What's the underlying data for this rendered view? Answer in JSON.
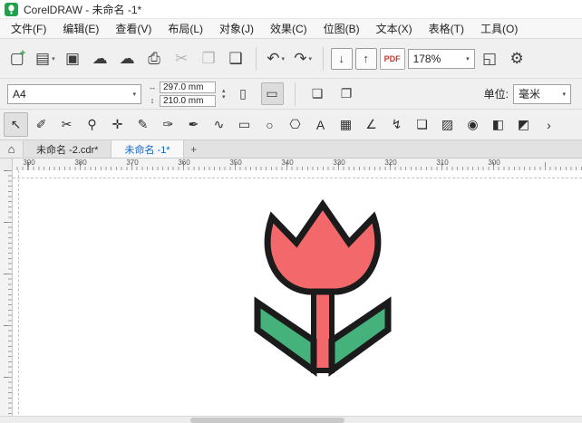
{
  "window": {
    "title": "CorelDRAW - 未命名 -1*"
  },
  "menu_bar": {
    "items": [
      "文件(F)",
      "编辑(E)",
      "查看(V)",
      "布局(L)",
      "对象(J)",
      "效果(C)",
      "位图(B)",
      "文本(X)",
      "表格(T)",
      "工具(O)"
    ]
  },
  "standard_toolbar": {
    "caret_glyph": "▾",
    "zoom_level": "178%",
    "buttons": {
      "new": {
        "glyph": "▢",
        "plus_glyph": "+"
      },
      "open": {
        "glyph": "▤",
        "has_menu": true
      },
      "save": {
        "glyph": "▣"
      },
      "cloud_download": {
        "glyph": "☁"
      },
      "cloud_upload": {
        "glyph": "☁"
      },
      "print": {
        "glyph": "⎙"
      },
      "cut": {
        "glyph": "✂",
        "disabled": true
      },
      "copy": {
        "glyph": "❐",
        "disabled": true
      },
      "paste": {
        "glyph": "❑"
      },
      "undo": {
        "glyph": "↶",
        "has_menu": true
      },
      "redo": {
        "glyph": "↷",
        "has_menu": true
      },
      "import": {
        "glyph": "↓"
      },
      "export": {
        "glyph": "↑"
      },
      "pdf": {
        "glyph": "PDF"
      },
      "fullscreen_preview": {
        "glyph": "◱"
      },
      "options": {
        "glyph": "⚙"
      }
    }
  },
  "property_bar": {
    "page_size": "A4",
    "width_value": "297.0 mm",
    "height_value": "210.0 mm",
    "width_icon": "↔",
    "height_icon": "↕",
    "spinner_up": "▴",
    "spinner_down": "▾",
    "portrait_glyph": "▯",
    "landscape_glyph": "▭",
    "current_page_glyph": "❏",
    "all_pages_glyph": "❐",
    "units_label": "单位:",
    "units_value": "毫米",
    "caret_glyph": "▾"
  },
  "toolbox": {
    "tools": [
      {
        "name": "pick-tool",
        "glyph": "↖",
        "active": true
      },
      {
        "name": "shape-tool",
        "glyph": "✐"
      },
      {
        "name": "crop-tool",
        "glyph": "✂"
      },
      {
        "name": "zoom-tool",
        "glyph": "⚲"
      },
      {
        "name": "pan-tool",
        "glyph": "✛"
      },
      {
        "name": "freehand-tool",
        "glyph": "✎"
      },
      {
        "name": "artistic-media-tool",
        "glyph": "✑"
      },
      {
        "name": "pen-tool",
        "glyph": "✒"
      },
      {
        "name": "bezier-tool",
        "glyph": "∿"
      },
      {
        "name": "rectangle-tool",
        "glyph": "▭"
      },
      {
        "name": "ellipse-tool",
        "glyph": "○"
      },
      {
        "name": "polygon-tool",
        "glyph": "⎔"
      },
      {
        "name": "text-tool",
        "glyph": "A"
      },
      {
        "name": "table-tool",
        "glyph": "▦"
      },
      {
        "name": "dimension-tool",
        "glyph": "∠"
      },
      {
        "name": "connector-tool",
        "glyph": "↯"
      },
      {
        "name": "drop-shadow-tool",
        "glyph": "❏"
      },
      {
        "name": "transparency-tool",
        "glyph": "▨"
      },
      {
        "name": "color-eyedropper-tool",
        "glyph": "◉"
      },
      {
        "name": "interactive-fill-tool",
        "glyph": "◧"
      },
      {
        "name": "smart-fill-tool",
        "glyph": "◩"
      },
      {
        "name": "toolbox-overflow",
        "glyph": "›"
      }
    ]
  },
  "document_tabs": {
    "home_glyph": "⌂",
    "tabs": [
      {
        "label": "未命名 -2.cdr*",
        "active": false
      },
      {
        "label": "未命名 -1*",
        "active": true
      }
    ],
    "new_tab_glyph": "+"
  },
  "ruler": {
    "h_labels": [
      "390",
      "380",
      "370",
      "360",
      "350",
      "340",
      "330",
      "320",
      "310",
      "300"
    ]
  },
  "canvas": {
    "artwork": "tulip-drawing",
    "petal_color": "#f3696b",
    "stem_color": "#f3696b",
    "leaf_color": "#45b27b",
    "outline_color": "#1b1b1b",
    "background": "#ffffff"
  }
}
